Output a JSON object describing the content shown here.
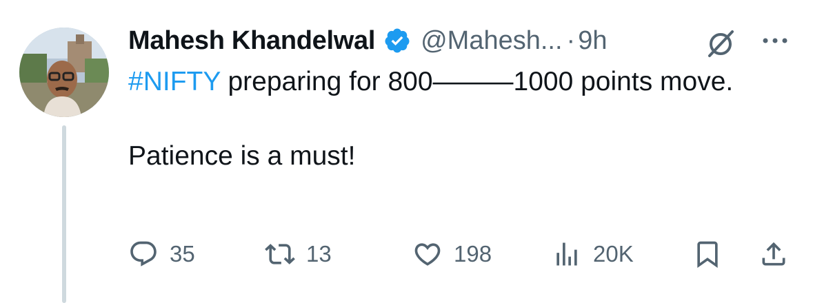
{
  "author": {
    "name": "Mahesh Khandelwal",
    "handle": "@Mahesh...",
    "separator": "·",
    "time": "9h",
    "verified": true
  },
  "tweet": {
    "hashtag": "#NIFTY",
    "line1_rest": " preparing for 800———1000 points move.",
    "line2": "Patience is a must!"
  },
  "actions": {
    "reply_count": "35",
    "retweet_count": "13",
    "like_count": "198",
    "views_count": "20K"
  },
  "colors": {
    "accent": "#1d9bf0",
    "text": "#0f1419",
    "muted": "#536471",
    "thread": "#cfd9de"
  },
  "icons": [
    "verified-badge-icon",
    "grok-icon",
    "more-icon",
    "reply-icon",
    "retweet-icon",
    "like-icon",
    "views-icon",
    "bookmark-icon",
    "share-icon"
  ]
}
